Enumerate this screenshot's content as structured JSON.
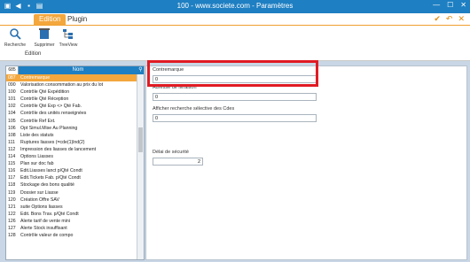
{
  "window": {
    "title": "100 - www.societe.com - Paramètres"
  },
  "tabs": [
    "Edition",
    "Plugin"
  ],
  "ribbon": {
    "buttons": [
      "Recherche",
      "Supprimer",
      "TreeView"
    ],
    "group_label": "Edition"
  },
  "list": {
    "header": {
      "count": "685",
      "name": "Nom"
    },
    "items": [
      {
        "code": "087",
        "label": "Contremarque",
        "selected": true
      },
      {
        "code": "090",
        "label": "Valorisation consommation au prix du lot"
      },
      {
        "code": "100",
        "label": "Contrôle Qté Expédition"
      },
      {
        "code": "101",
        "label": "Contrôle Qté Réception"
      },
      {
        "code": "102",
        "label": "Contrôle Qté Exp <> Qté Fab."
      },
      {
        "code": "104",
        "label": "Contrôle des unités renseignées"
      },
      {
        "code": "105",
        "label": "Contrôle Ref Ext."
      },
      {
        "code": "106",
        "label": "Opt Simul.Mise Au Planning"
      },
      {
        "code": "108",
        "label": "Liste des statuts"
      },
      {
        "code": "111",
        "label": "Ruptures liasses (=cde(1)lnd(2)"
      },
      {
        "code": "112",
        "label": "Impression des liasses de lancement"
      },
      {
        "code": "114",
        "label": "Options Liasses"
      },
      {
        "code": "115",
        "label": "Plan sur doc fab"
      },
      {
        "code": "116",
        "label": "Edit.Liasses lanct p/Qté Condt"
      },
      {
        "code": "117",
        "label": "Edit.Tickets Fab. p/Qté Condt"
      },
      {
        "code": "118",
        "label": "Stockage des bons qualité"
      },
      {
        "code": "119",
        "label": "Dossier sur Liasse"
      },
      {
        "code": "120",
        "label": "Création Offre SAV"
      },
      {
        "code": "121",
        "label": "suite Options liasses"
      },
      {
        "code": "122",
        "label": "Edit. Bons Trav. p/Qté Condt"
      },
      {
        "code": "126",
        "label": "Alerte tarif de vente mini"
      },
      {
        "code": "127",
        "label": "Alerte Stock insuffisant"
      },
      {
        "code": "128",
        "label": "Contrôle valeur de compo"
      }
    ]
  },
  "form": {
    "contremarque": {
      "label": "Contremarque",
      "value": "0"
    },
    "adresse_livraison": {
      "label": "Adresse de livraison",
      "value": "0"
    },
    "recherche_cdes": {
      "label": "Afficher recherche sélective des Cdes",
      "value": "0"
    },
    "delai_securite": {
      "label": "Délai de sécurité",
      "value": "2"
    }
  },
  "colors": {
    "accent": "#f3a73d",
    "title_blue": "#1e7fc2",
    "highlight": "#e01b24"
  }
}
